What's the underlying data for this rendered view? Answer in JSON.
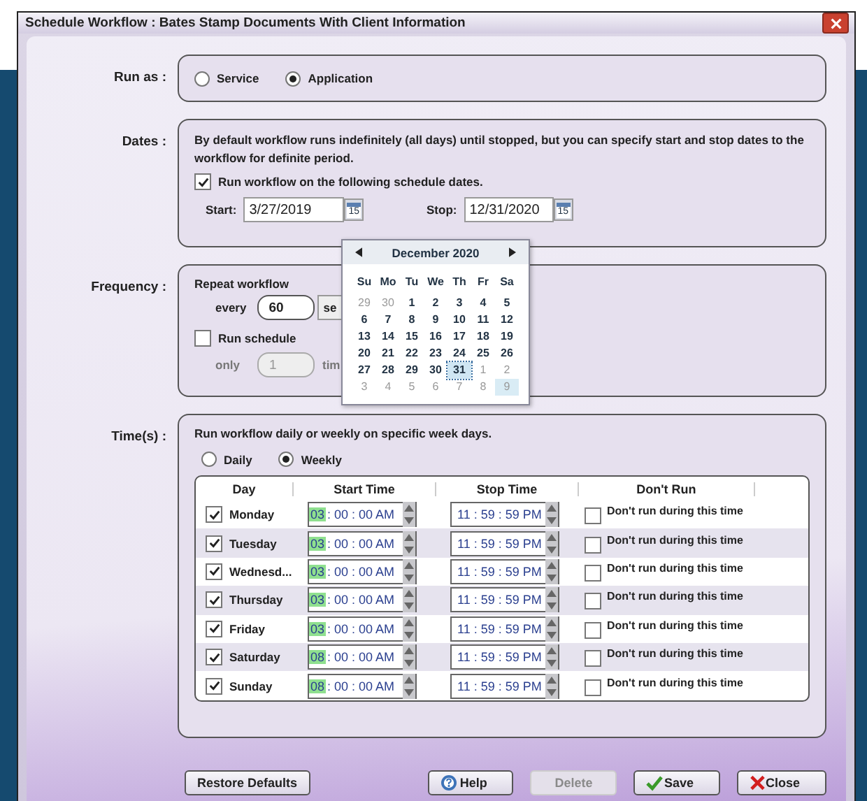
{
  "window": {
    "title": "Schedule Workflow : Bates Stamp Documents With Client Information"
  },
  "run_as": {
    "label": "Run as :",
    "options": [
      {
        "label": "Service",
        "selected": false
      },
      {
        "label": "Application",
        "selected": true
      }
    ]
  },
  "dates": {
    "label": "Dates :",
    "description": "By default workflow runs indefinitely (all days) until stopped, but you can specify start and stop dates to the workflow for definite period.",
    "schedule_dates": {
      "label": "Run workflow on the following schedule dates.",
      "checked": true
    },
    "start": {
      "label": "Start:",
      "value": "3/27/2019",
      "icon_text": "15"
    },
    "stop": {
      "label": "Stop:",
      "value": "12/31/2020",
      "icon_text": "15"
    }
  },
  "frequency": {
    "label": "Frequency :",
    "repeat_label": "Repeat workflow",
    "every_label": "every",
    "every_value": "60",
    "unit": "se",
    "run_schedule": {
      "label": "Run schedule",
      "checked": false
    },
    "only_label": "only",
    "only_value": "1",
    "only_disabled": true,
    "times_label": "tim"
  },
  "calendar": {
    "month": "December 2020",
    "weekdays": [
      "Su",
      "Mo",
      "Tu",
      "We",
      "Th",
      "Fr",
      "Sa"
    ],
    "days": [
      {
        "label": "29",
        "muted": true,
        "selected": false,
        "hovered": false
      },
      {
        "label": "30",
        "muted": true,
        "selected": false,
        "hovered": false
      },
      {
        "label": "1",
        "muted": false,
        "selected": false,
        "hovered": false
      },
      {
        "label": "2",
        "muted": false,
        "selected": false,
        "hovered": false
      },
      {
        "label": "3",
        "muted": false,
        "selected": false,
        "hovered": false
      },
      {
        "label": "4",
        "muted": false,
        "selected": false,
        "hovered": false
      },
      {
        "label": "5",
        "muted": false,
        "selected": false,
        "hovered": false
      },
      {
        "label": "6",
        "muted": false,
        "selected": false,
        "hovered": false
      },
      {
        "label": "7",
        "muted": false,
        "selected": false,
        "hovered": false
      },
      {
        "label": "8",
        "muted": false,
        "selected": false,
        "hovered": false
      },
      {
        "label": "9",
        "muted": false,
        "selected": false,
        "hovered": false
      },
      {
        "label": "10",
        "muted": false,
        "selected": false,
        "hovered": false
      },
      {
        "label": "11",
        "muted": false,
        "selected": false,
        "hovered": false
      },
      {
        "label": "12",
        "muted": false,
        "selected": false,
        "hovered": false
      },
      {
        "label": "13",
        "muted": false,
        "selected": false,
        "hovered": false
      },
      {
        "label": "14",
        "muted": false,
        "selected": false,
        "hovered": false
      },
      {
        "label": "15",
        "muted": false,
        "selected": false,
        "hovered": false
      },
      {
        "label": "16",
        "muted": false,
        "selected": false,
        "hovered": false
      },
      {
        "label": "17",
        "muted": false,
        "selected": false,
        "hovered": false
      },
      {
        "label": "18",
        "muted": false,
        "selected": false,
        "hovered": false
      },
      {
        "label": "19",
        "muted": false,
        "selected": false,
        "hovered": false
      },
      {
        "label": "20",
        "muted": false,
        "selected": false,
        "hovered": false
      },
      {
        "label": "21",
        "muted": false,
        "selected": false,
        "hovered": false
      },
      {
        "label": "22",
        "muted": false,
        "selected": false,
        "hovered": false
      },
      {
        "label": "23",
        "muted": false,
        "selected": false,
        "hovered": false
      },
      {
        "label": "24",
        "muted": false,
        "selected": false,
        "hovered": false
      },
      {
        "label": "25",
        "muted": false,
        "selected": false,
        "hovered": false
      },
      {
        "label": "26",
        "muted": false,
        "selected": false,
        "hovered": false
      },
      {
        "label": "27",
        "muted": false,
        "selected": false,
        "hovered": false
      },
      {
        "label": "28",
        "muted": false,
        "selected": false,
        "hovered": false
      },
      {
        "label": "29",
        "muted": false,
        "selected": false,
        "hovered": false
      },
      {
        "label": "30",
        "muted": false,
        "selected": false,
        "hovered": false
      },
      {
        "label": "31",
        "muted": false,
        "selected": true,
        "hovered": false
      },
      {
        "label": "1",
        "muted": true,
        "selected": false,
        "hovered": false
      },
      {
        "label": "2",
        "muted": true,
        "selected": false,
        "hovered": false
      },
      {
        "label": "3",
        "muted": true,
        "selected": false,
        "hovered": false
      },
      {
        "label": "4",
        "muted": true,
        "selected": false,
        "hovered": false
      },
      {
        "label": "5",
        "muted": true,
        "selected": false,
        "hovered": false
      },
      {
        "label": "6",
        "muted": true,
        "selected": false,
        "hovered": false
      },
      {
        "label": "7",
        "muted": true,
        "selected": false,
        "hovered": false
      },
      {
        "label": "8",
        "muted": true,
        "selected": false,
        "hovered": false
      },
      {
        "label": "9",
        "muted": true,
        "selected": false,
        "hovered": true
      }
    ]
  },
  "times": {
    "label": "Time(s) :",
    "description": "Run workflow daily or weekly on specific week days.",
    "modes": [
      {
        "label": "Daily",
        "selected": false
      },
      {
        "label": "Weekly",
        "selected": true
      }
    ],
    "table": {
      "columns": [
        "Day",
        "Start Time",
        "Stop Time",
        "Don't Run"
      ],
      "rows": [
        {
          "day": "Monday",
          "checked": true,
          "start_hour": "03",
          "hour_focused": true,
          "start_rest": ": 00 : 00 AM",
          "stop_time": "11 : 59 : 59 PM",
          "dont_run": {
            "label": "Don't run during this time",
            "checked": false
          }
        },
        {
          "day": "Tuesday",
          "checked": true,
          "start_hour": "03",
          "hour_focused": true,
          "start_rest": ": 00 : 00 AM",
          "stop_time": "11 : 59 : 59 PM",
          "dont_run": {
            "label": "Don't run during this time",
            "checked": false
          }
        },
        {
          "day": "Wednesd...",
          "checked": true,
          "start_hour": "03",
          "hour_focused": true,
          "start_rest": ": 00 : 00 AM",
          "stop_time": "11 : 59 : 59 PM",
          "dont_run": {
            "label": "Don't run during this time",
            "checked": false
          }
        },
        {
          "day": "Thursday",
          "checked": true,
          "start_hour": "03",
          "hour_focused": true,
          "start_rest": ": 00 : 00 AM",
          "stop_time": "11 : 59 : 59 PM",
          "dont_run": {
            "label": "Don't run during this time",
            "checked": false
          }
        },
        {
          "day": "Friday",
          "checked": true,
          "start_hour": "03",
          "hour_focused": true,
          "start_rest": ": 00 : 00 AM",
          "stop_time": "11 : 59 : 59 PM",
          "dont_run": {
            "label": "Don't run during this time",
            "checked": false
          }
        },
        {
          "day": "Saturday",
          "checked": true,
          "start_hour": "08",
          "hour_focused": true,
          "start_rest": ": 00 : 00 AM",
          "stop_time": "11 : 59 : 59 PM",
          "dont_run": {
            "label": "Don't run during this time",
            "checked": false
          }
        },
        {
          "day": "Sunday",
          "checked": true,
          "start_hour": "08",
          "hour_focused": true,
          "start_rest": ": 00 : 00 AM",
          "stop_time": "11 : 59 : 59 PM",
          "dont_run": {
            "label": "Don't run during this time",
            "checked": false
          }
        }
      ]
    }
  },
  "buttons": [
    {
      "label": "Restore Defaults",
      "kind": "plain",
      "disabled": false
    },
    {
      "label": "Help",
      "kind": "help",
      "disabled": false
    },
    {
      "label": "Delete",
      "kind": "plain",
      "disabled": true
    },
    {
      "label": "Save",
      "kind": "save",
      "disabled": false
    },
    {
      "label": "Close",
      "kind": "close",
      "disabled": false
    }
  ]
}
